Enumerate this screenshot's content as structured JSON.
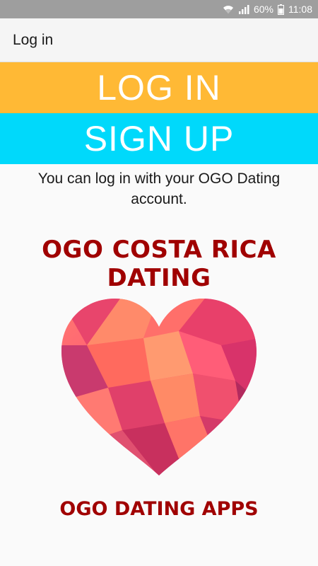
{
  "status_bar": {
    "battery_percent": "60%",
    "time": "11:08",
    "icons": [
      "wifi-icon",
      "signal-icon",
      "battery-icon"
    ]
  },
  "app_bar": {
    "title": "Log in"
  },
  "buttons": {
    "login_label": "LOG IN",
    "signup_label": "SIGN UP"
  },
  "info_text": "You can log in with your OGO Dating account.",
  "brand": {
    "title": "OGO COSTA RICA DATING",
    "footer": "OGO DATING APPS",
    "logo_icon": "heart-icon"
  },
  "colors": {
    "login": "#ffb935",
    "signup": "#00d9fb",
    "brand_text": "#a00000",
    "status_bar": "#9e9e9e"
  }
}
